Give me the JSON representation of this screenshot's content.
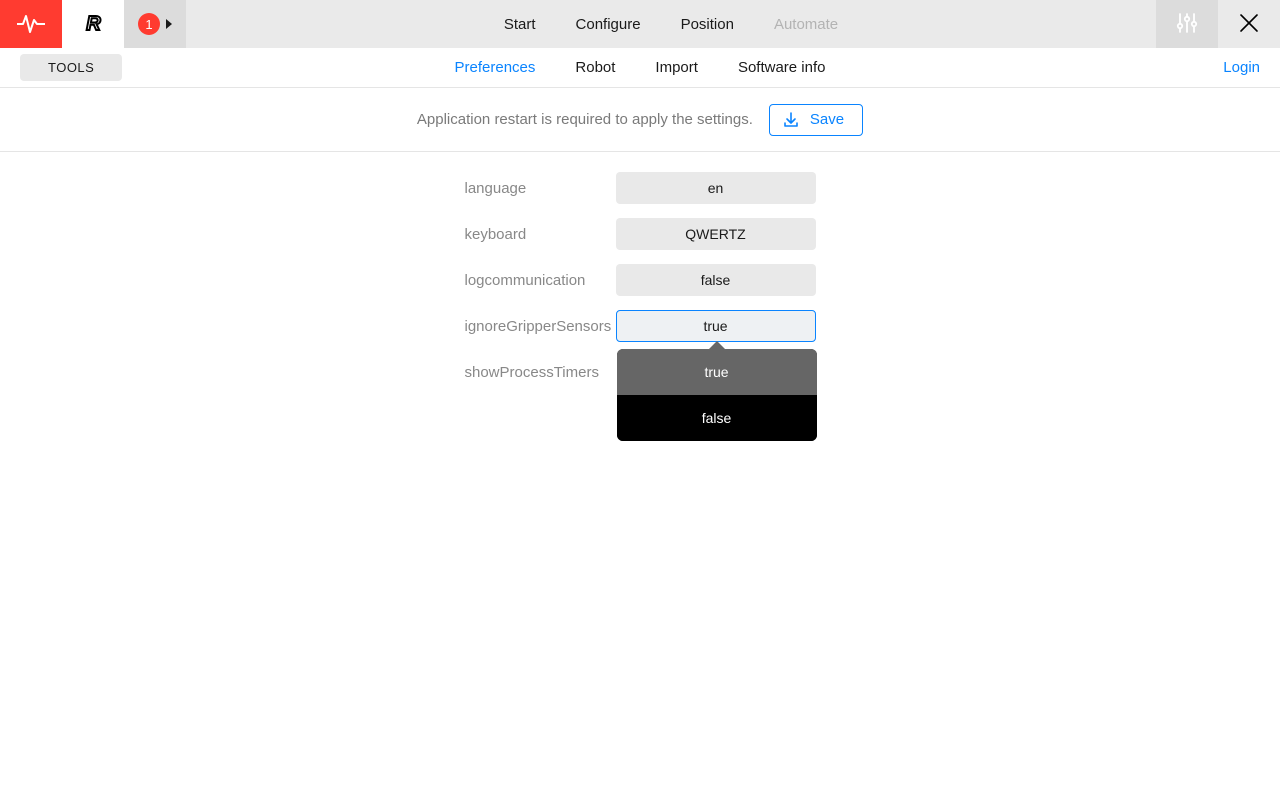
{
  "topbar": {
    "badge_count": "1"
  },
  "topnav": {
    "items": [
      {
        "label": "Start",
        "disabled": false
      },
      {
        "label": "Configure",
        "disabled": false
      },
      {
        "label": "Position",
        "disabled": false
      },
      {
        "label": "Automate",
        "disabled": true
      }
    ]
  },
  "subbar": {
    "tools_label": "TOOLS",
    "tabs": [
      {
        "label": "Preferences",
        "active": true
      },
      {
        "label": "Robot",
        "active": false
      },
      {
        "label": "Import",
        "active": false
      },
      {
        "label": "Software info",
        "active": false
      }
    ],
    "login_label": "Login"
  },
  "info_row": {
    "message": "Application restart is required to apply the settings.",
    "save_label": "Save"
  },
  "settings": {
    "rows": [
      {
        "label": "language",
        "value": "en",
        "active": false
      },
      {
        "label": "keyboard",
        "value": "QWERTZ",
        "active": false
      },
      {
        "label": "logcommunication",
        "value": "false",
        "active": false
      },
      {
        "label": "ignoreGripperSensors",
        "value": "true",
        "active": true
      },
      {
        "label": "showProcessTimers",
        "value": "",
        "active": false
      }
    ],
    "dropdown": {
      "options": [
        {
          "label": "true",
          "selected": true
        },
        {
          "label": "false",
          "selected": false
        }
      ]
    }
  }
}
